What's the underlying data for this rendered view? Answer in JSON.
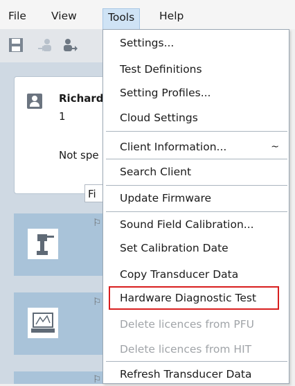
{
  "menubar": {
    "items": [
      {
        "label": "File"
      },
      {
        "label": "View"
      },
      {
        "label": "Tools"
      },
      {
        "label": "Help"
      }
    ]
  },
  "client": {
    "name": "Richard",
    "number": "1",
    "status": "Not spe"
  },
  "filter": {
    "label": "Fi"
  },
  "tools_menu": {
    "items": [
      {
        "label": "Settings..."
      },
      {
        "label": "Test Definitions"
      },
      {
        "label": "Setting Profiles..."
      },
      {
        "label": "Cloud Settings"
      },
      {
        "label": "Client Information...",
        "shortcut": "~"
      },
      {
        "label": "Search Client"
      },
      {
        "label": "Update Firmware"
      },
      {
        "label": "Sound Field Calibration..."
      },
      {
        "label": "Set Calibration Date"
      },
      {
        "label": "Copy Transducer Data"
      },
      {
        "label": "Hardware Diagnostic Test"
      },
      {
        "label": "Delete licences from PFU"
      },
      {
        "label": "Delete licences from HIT"
      },
      {
        "label": "Refresh Transducer Data"
      }
    ]
  },
  "colors": {
    "active_menu": "#cfe3f5",
    "highlight_border": "#d81e1e",
    "disabled_text": "#a0a4a8",
    "tile": "#a9c3d9"
  }
}
